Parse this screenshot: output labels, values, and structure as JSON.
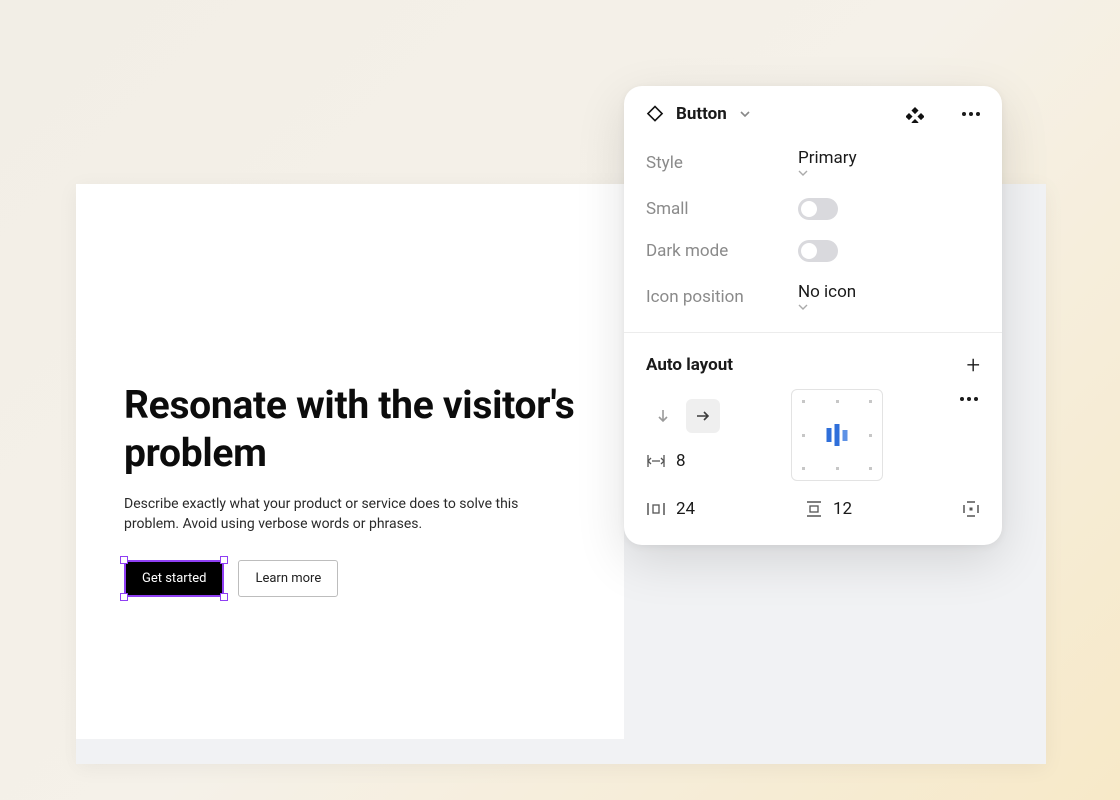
{
  "canvas": {
    "heading": "Resonate with the visitor's problem",
    "subtext": "Describe exactly what your product or service does to solve this problem. Avoid using verbose words or phrases.",
    "primary_btn": "Get started",
    "secondary_btn": "Learn more"
  },
  "panel": {
    "component_name": "Button",
    "props": {
      "style_label": "Style",
      "style_value": "Primary",
      "small_label": "Small",
      "small_value": false,
      "dark_label": "Dark mode",
      "dark_value": false,
      "icon_label": "Icon position",
      "icon_value": "No icon"
    },
    "autolayout": {
      "title": "Auto layout",
      "direction": "horizontal",
      "item_spacing": "8",
      "padding_h": "24",
      "padding_v": "12"
    }
  }
}
